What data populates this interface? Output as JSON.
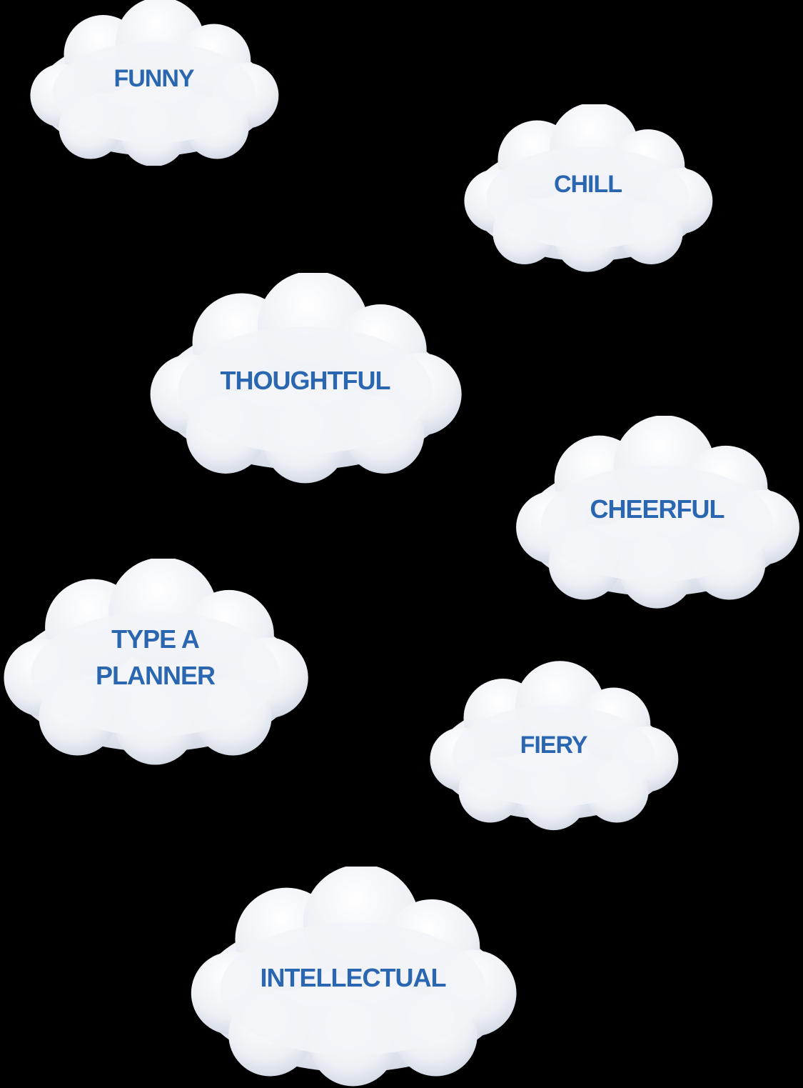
{
  "colors": {
    "background": "#000000",
    "cloud_fill": "#eef1f6",
    "cloud_shadow": "#b9c3d4",
    "label": "#2b67b0"
  },
  "clouds": [
    {
      "label": "FUNNY"
    },
    {
      "label": "CHILL"
    },
    {
      "label": "THOUGHTFUL"
    },
    {
      "label": "CHEERFUL"
    },
    {
      "line1": "TYPE A",
      "line2": "PLANNER"
    },
    {
      "label": "FIERY"
    },
    {
      "label": "INTELLECTUAL"
    }
  ]
}
